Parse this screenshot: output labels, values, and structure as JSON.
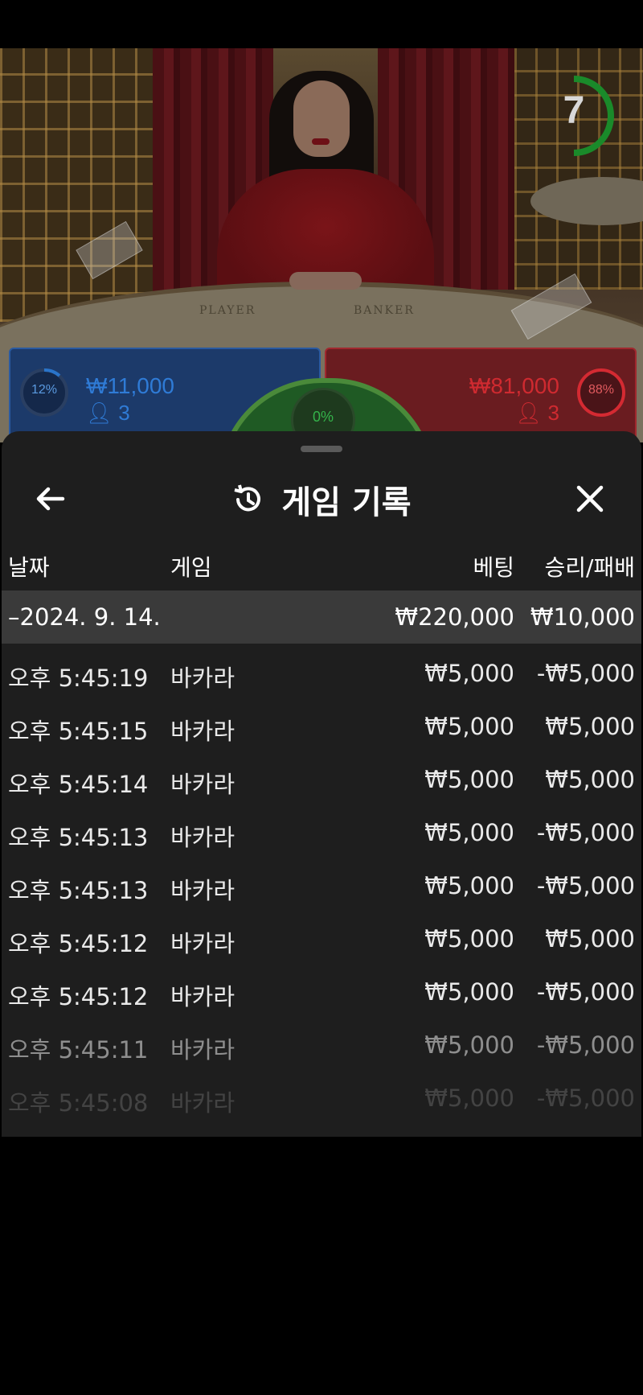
{
  "stage": {
    "timer": "7",
    "table_labels": {
      "player": "PLAYER",
      "banker": "BANKER"
    },
    "player": {
      "percent": "12%",
      "amount": "₩11,000",
      "count": "3"
    },
    "banker": {
      "percent": "88%",
      "amount": "₩81,000",
      "count": "3"
    },
    "tie": {
      "percent": "0%"
    },
    "colors": {
      "player": "#2a74c9",
      "banker": "#d42a32",
      "tie": "#34b34a"
    }
  },
  "history": {
    "title": "게임 기록",
    "columns": {
      "date": "날짜",
      "game": "게임",
      "bet": "베팅",
      "result": "승리/패배"
    },
    "date_group": {
      "date": "–2024. 9. 14.",
      "bet_total": "₩220,000",
      "result_total": "₩10,000"
    },
    "rows": [
      {
        "time": "오후 5:45:19",
        "game": "바카라",
        "bet": "₩5,000",
        "result": "-₩5,000"
      },
      {
        "time": "오후 5:45:15",
        "game": "바카라",
        "bet": "₩5,000",
        "result": "₩5,000"
      },
      {
        "time": "오후 5:45:14",
        "game": "바카라",
        "bet": "₩5,000",
        "result": "₩5,000"
      },
      {
        "time": "오후 5:45:13",
        "game": "바카라",
        "bet": "₩5,000",
        "result": "-₩5,000"
      },
      {
        "time": "오후 5:45:13",
        "game": "바카라",
        "bet": "₩5,000",
        "result": "-₩5,000"
      },
      {
        "time": "오후 5:45:12",
        "game": "바카라",
        "bet": "₩5,000",
        "result": "₩5,000"
      },
      {
        "time": "오후 5:45:12",
        "game": "바카라",
        "bet": "₩5,000",
        "result": "-₩5,000"
      },
      {
        "time": "오후 5:45:11",
        "game": "바카라",
        "bet": "₩5,000",
        "result": "-₩5,000"
      },
      {
        "time": "오후 5:45:08",
        "game": "바카라",
        "bet": "₩5,000",
        "result": "-₩5,000"
      }
    ]
  }
}
